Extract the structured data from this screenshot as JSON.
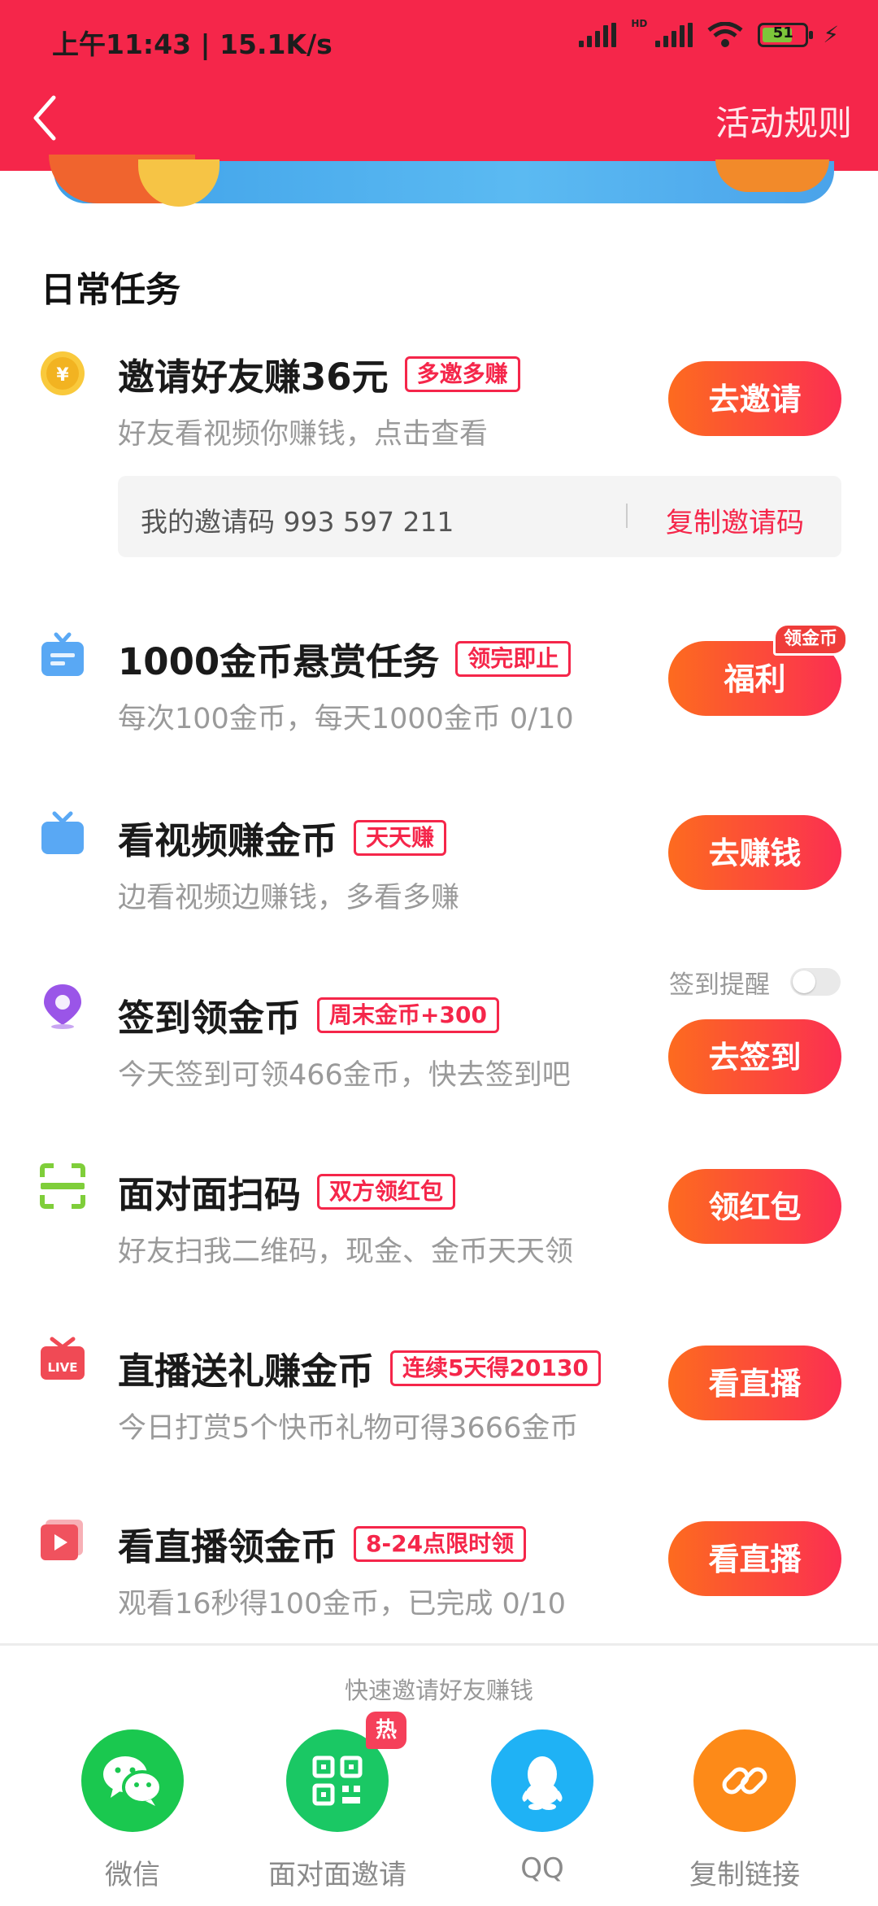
{
  "status_bar": {
    "time_speed": "上午11:43 | 15.1K/s",
    "hd_label": "HD",
    "battery_level": "51"
  },
  "header": {
    "rules_label": "活动规则"
  },
  "colors": {
    "header_red": "#f5264a",
    "button_orange": "#fd6b1f",
    "button_red": "#fb2f51"
  },
  "section_title": "日常任务",
  "tasks": [
    {
      "icon": "coin-icon",
      "title": "邀请好友赚36元",
      "badge": "多邀多赚",
      "subtitle": "好友看视频你赚钱，点击查看",
      "action": "去邀请"
    },
    {
      "icon": "gift-box-icon",
      "title": "1000金币悬赏任务",
      "badge": "领完即止",
      "subtitle": "每次100金币，每天1000金币 0/10",
      "action": "福利",
      "action_tag": "领金币"
    },
    {
      "icon": "tv-icon",
      "title": "看视频赚金币",
      "badge": "天天赚",
      "subtitle": "边看视频边赚钱，多看多赚",
      "action": "去赚钱"
    },
    {
      "icon": "location-pin-icon",
      "title": "签到领金币",
      "badge": "周末金币+300",
      "subtitle": "今天签到可领466金币，快去签到吧",
      "action": "去签到"
    },
    {
      "icon": "scan-icon",
      "title": "面对面扫码",
      "badge": "双方领红包",
      "subtitle": "好友扫我二维码，现金、金币天天领",
      "action": "领红包"
    },
    {
      "icon": "live-gift-icon",
      "title": "直播送礼赚金币",
      "badge": "连续5天得20130",
      "subtitle": "今日打赏5个快币礼物可得3666金币",
      "action": "看直播"
    },
    {
      "icon": "play-icon",
      "title": "看直播领金币",
      "badge": "8-24点限时领",
      "subtitle": "观看16秒得100金币，已完成 0/10",
      "action": "看直播"
    }
  ],
  "invite": {
    "code_text": "我的邀请码 993 597 211",
    "copy_label": "复制邀请码"
  },
  "checkin_reminder": {
    "label": "签到提醒",
    "enabled": false
  },
  "share": {
    "title": "快速邀请好友赚钱",
    "items": [
      {
        "label": "微信",
        "icon": "wechat-icon",
        "color": "#1ac84f"
      },
      {
        "label": "面对面邀请",
        "icon": "qr-code-icon",
        "color": "#1ac864",
        "tag": "热"
      },
      {
        "label": "QQ",
        "icon": "qq-icon",
        "color": "#1fb2f5"
      },
      {
        "label": "复制链接",
        "icon": "link-icon",
        "color": "#fd8a18"
      }
    ]
  }
}
